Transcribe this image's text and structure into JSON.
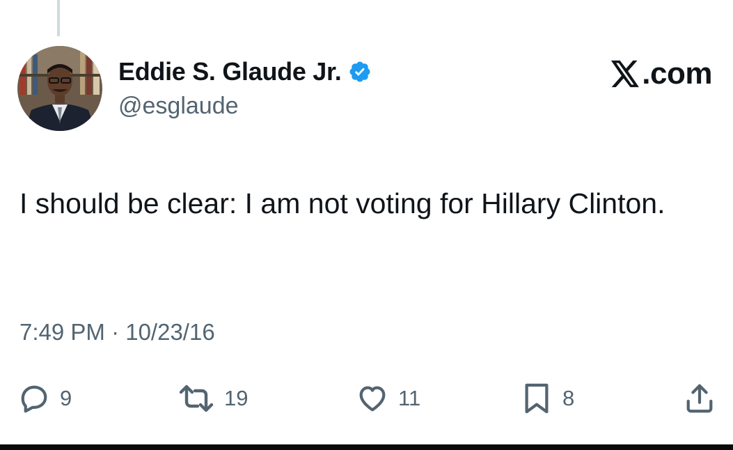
{
  "tweet": {
    "author": {
      "display_name": "Eddie S. Glaude Jr.",
      "handle": "@esglaude",
      "verified": true
    },
    "brand": {
      "logo_icon": "x-logo-icon",
      "suffix": ".com"
    },
    "text": "I should be clear: I am not voting for Hillary Clinton.",
    "timestamp": "7:49 PM · 10/23/16",
    "actions": {
      "replies": {
        "icon": "reply-icon",
        "count": "9"
      },
      "reposts": {
        "icon": "repost-icon",
        "count": "19"
      },
      "likes": {
        "icon": "heart-icon",
        "count": "11"
      },
      "bookmarks": {
        "icon": "bookmark-icon",
        "count": "8"
      },
      "share": {
        "icon": "share-icon"
      }
    }
  },
  "colors": {
    "text_primary": "#0f1419",
    "text_secondary": "#536471",
    "verified_blue": "#1d9bf0",
    "thread_line": "#cfd9de"
  }
}
